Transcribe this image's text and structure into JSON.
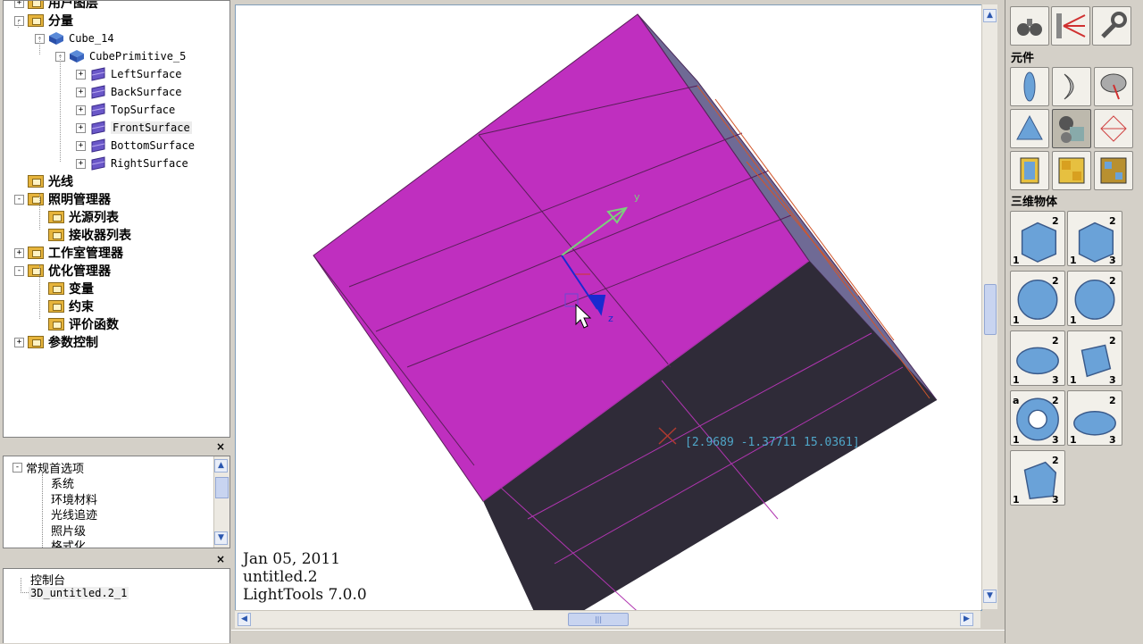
{
  "tree": {
    "items": [
      {
        "label": "用户图层",
        "depth": 1,
        "type": "folder",
        "expander": "+"
      },
      {
        "label": "分量",
        "depth": 1,
        "type": "folder",
        "expander": "-"
      },
      {
        "label": "Cube_14",
        "depth": 2,
        "type": "cube",
        "expander": "-"
      },
      {
        "label": "CubePrimitive_5",
        "depth": 3,
        "type": "cube",
        "expander": "-"
      },
      {
        "label": "LeftSurface",
        "depth": 4,
        "type": "surface",
        "expander": "+"
      },
      {
        "label": "BackSurface",
        "depth": 4,
        "type": "surface",
        "expander": "+"
      },
      {
        "label": "TopSurface",
        "depth": 4,
        "type": "surface",
        "expander": "+"
      },
      {
        "label": "FrontSurface",
        "depth": 4,
        "type": "surface",
        "expander": "+",
        "selected": true
      },
      {
        "label": "BottomSurface",
        "depth": 4,
        "type": "surface",
        "expander": "+"
      },
      {
        "label": "RightSurface",
        "depth": 4,
        "type": "surface",
        "expander": "+"
      },
      {
        "label": "光线",
        "depth": 1,
        "type": "folder",
        "expander": ""
      },
      {
        "label": "照明管理器",
        "depth": 1,
        "type": "folder",
        "expander": "-"
      },
      {
        "label": "光源列表",
        "depth": 2,
        "type": "folder",
        "expander": ""
      },
      {
        "label": "接收器列表",
        "depth": 2,
        "type": "folder",
        "expander": ""
      },
      {
        "label": "工作室管理器",
        "depth": 1,
        "type": "folder",
        "expander": "+"
      },
      {
        "label": "优化管理器",
        "depth": 1,
        "type": "folder",
        "expander": "-"
      },
      {
        "label": "变量",
        "depth": 2,
        "type": "folder",
        "expander": ""
      },
      {
        "label": "约束",
        "depth": 2,
        "type": "folder",
        "expander": ""
      },
      {
        "label": "评价函数",
        "depth": 2,
        "type": "folder",
        "expander": ""
      },
      {
        "label": "参数控制",
        "depth": 1,
        "type": "folder",
        "expander": "+"
      }
    ]
  },
  "preferences": {
    "close_glyph": "×",
    "root": "常规首选项",
    "root_expander": "-",
    "items": [
      "系统",
      "环境材料",
      "光线追迹",
      "照片级",
      "格式化"
    ]
  },
  "console": {
    "close_glyph": "×",
    "root": "控制台",
    "items": [
      "3D_untitled.2_1"
    ]
  },
  "viewport": {
    "date": "Jan 05, 2011",
    "file": "untitled.2",
    "app": "LightTools 7.0.0",
    "coords": "[2.9689 -1.37711 15.0361]",
    "axis_y": "y",
    "axis_z": "z",
    "colors": {
      "face_top": "#bf2fbf",
      "face_dark": "#2f2b38",
      "face_side": "#6f6a95",
      "edge": "#5a1f5a",
      "axis_y": "#7ccf7c",
      "axis_z": "#1a2ad0"
    }
  },
  "scrollbars": {
    "up": "▲",
    "down": "▼",
    "left": "◀",
    "right": "▶",
    "grip": "|||"
  },
  "palette": {
    "section_components": "元件",
    "section_3d": "三维物体",
    "top_icons": [
      "binoculars-icon",
      "ray-fan-icon",
      "wrench-icon"
    ],
    "component_icons": [
      "lens-icon",
      "mirror-icon",
      "reflector-icon",
      "prism-icon",
      "solids-icon",
      "grid-plane-icon",
      "box-icon",
      "lens-array-icon",
      "array-icon"
    ],
    "solid_icons": [
      {
        "name": "block-2pt-icon",
        "labels": [
          "1",
          "2"
        ]
      },
      {
        "name": "block-3pt-icon",
        "labels": [
          "1",
          "2",
          "3"
        ]
      },
      {
        "name": "sphere-2pt-icon",
        "labels": [
          "1",
          "2"
        ]
      },
      {
        "name": "sphere-edge-icon",
        "labels": [
          "1",
          "2"
        ]
      },
      {
        "name": "ellipsoid-icon",
        "labels": [
          "1",
          "2",
          "3"
        ]
      },
      {
        "name": "cylinder-icon",
        "labels": [
          "1",
          "2",
          "3"
        ]
      },
      {
        "name": "torus-icon",
        "labels": [
          "1",
          "2",
          "3",
          "a"
        ]
      },
      {
        "name": "elliptic-cylinder-icon",
        "labels": [
          "1",
          "2",
          "3"
        ]
      },
      {
        "name": "wedge-icon",
        "labels": [
          "1",
          "2",
          "3"
        ]
      }
    ]
  }
}
